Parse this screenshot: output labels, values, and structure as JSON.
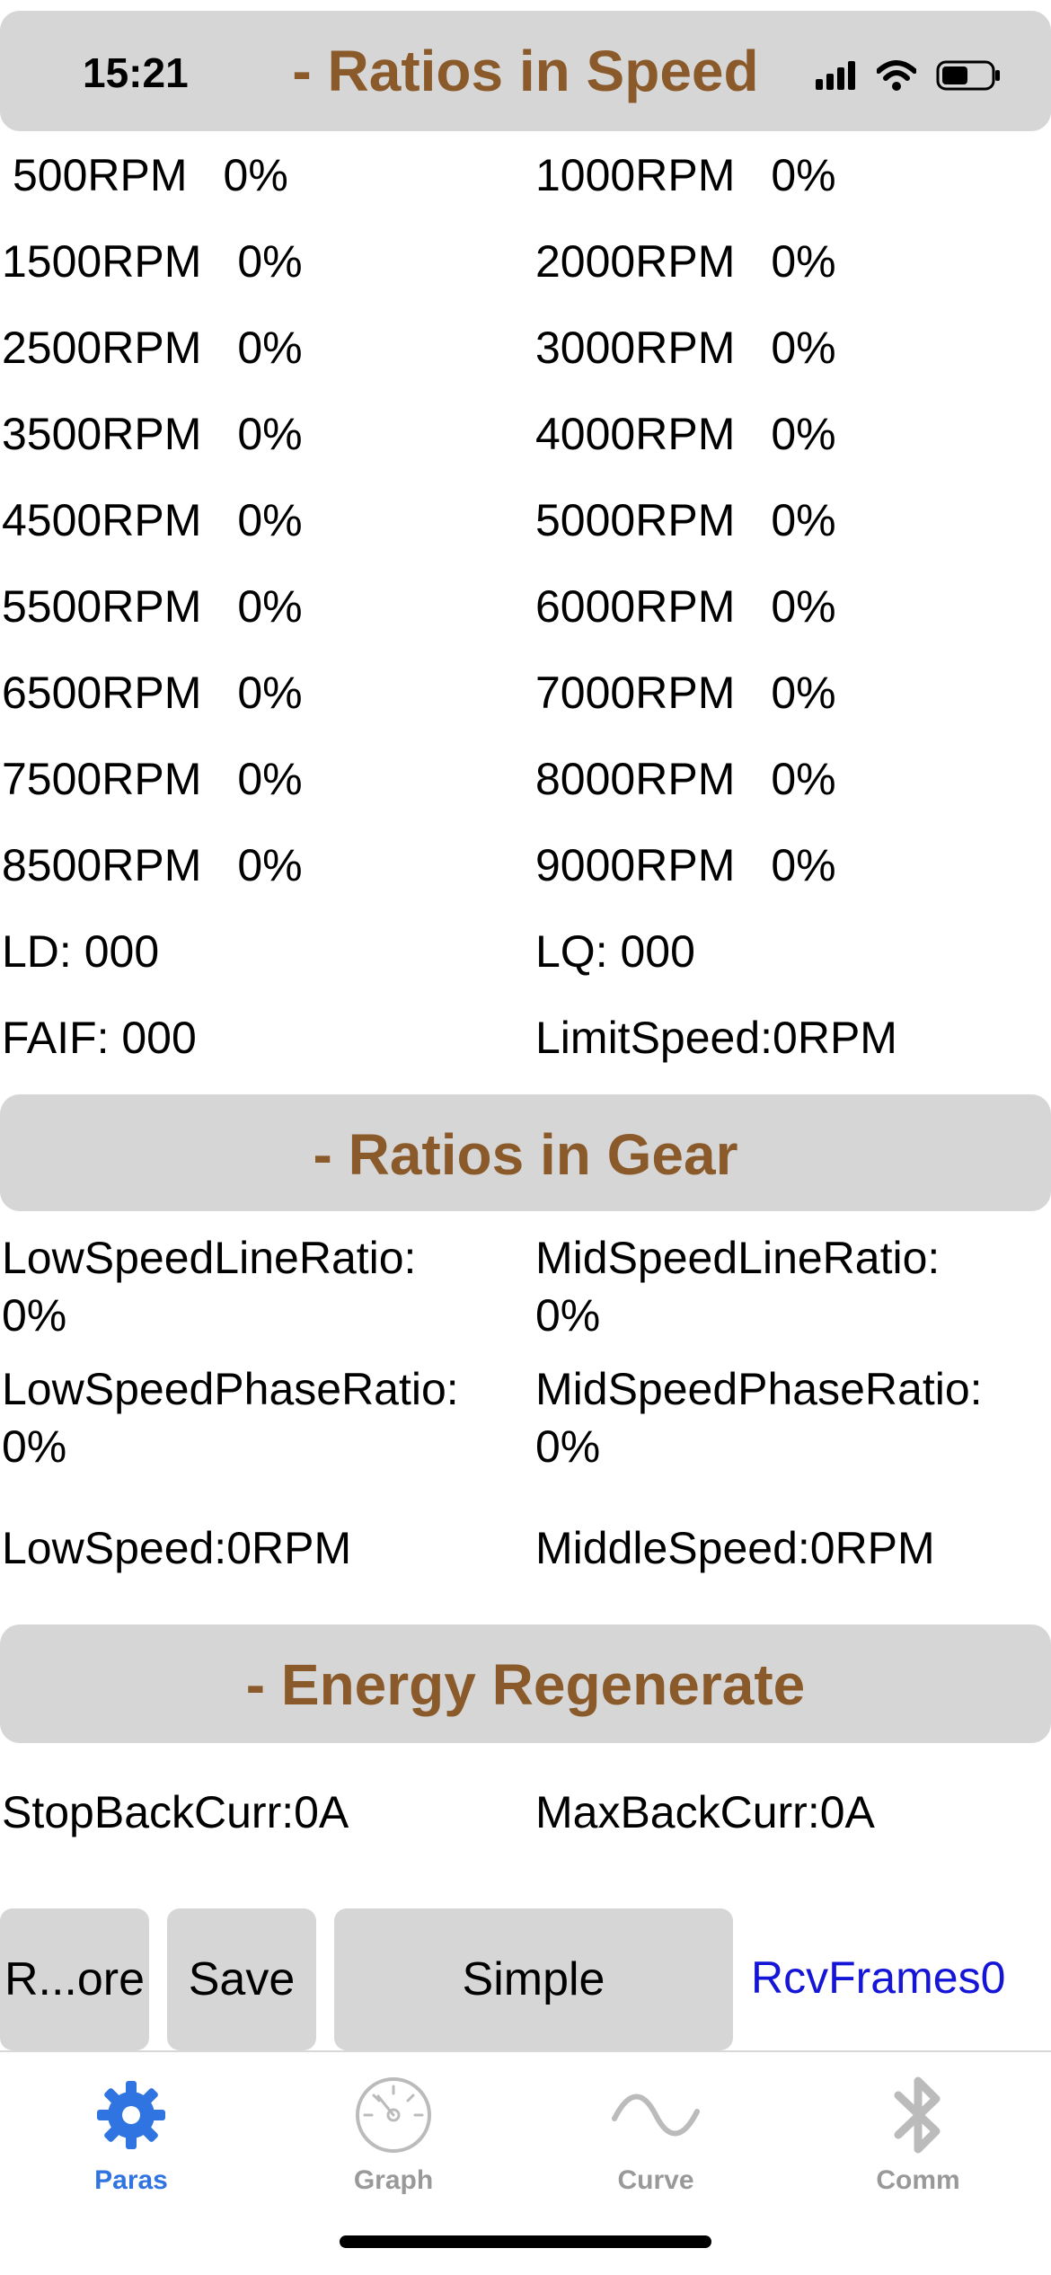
{
  "status": {
    "time": "15:21"
  },
  "speed_section": {
    "title": "- Ratios in Speed",
    "rows": [
      [
        {
          "label": "500RPM",
          "value": "0%"
        },
        {
          "label": "1000RPM",
          "value": "0%"
        }
      ],
      [
        {
          "label": "1500RPM",
          "value": "0%"
        },
        {
          "label": "2000RPM",
          "value": "0%"
        }
      ],
      [
        {
          "label": "2500RPM",
          "value": "0%"
        },
        {
          "label": "3000RPM",
          "value": "0%"
        }
      ],
      [
        {
          "label": "3500RPM",
          "value": "0%"
        },
        {
          "label": "4000RPM",
          "value": "0%"
        }
      ],
      [
        {
          "label": "4500RPM",
          "value": "0%"
        },
        {
          "label": "5000RPM",
          "value": "0%"
        }
      ],
      [
        {
          "label": "5500RPM",
          "value": "0%"
        },
        {
          "label": "6000RPM",
          "value": "0%"
        }
      ],
      [
        {
          "label": "6500RPM",
          "value": "0%"
        },
        {
          "label": "7000RPM",
          "value": "0%"
        }
      ],
      [
        {
          "label": "7500RPM",
          "value": "0%"
        },
        {
          "label": "8000RPM",
          "value": "0%"
        }
      ],
      [
        {
          "label": "8500RPM",
          "value": "0%"
        },
        {
          "label": "9000RPM",
          "value": "0%"
        }
      ]
    ],
    "ld": "LD: 000",
    "lq": "LQ: 000",
    "faif": "FAIF: 000",
    "limit_speed": "LimitSpeed:0RPM"
  },
  "gear_section": {
    "title": "- Ratios in Gear",
    "low_line_label": "LowSpeedLineRatio:",
    "low_line_value": "0%",
    "mid_line_label": "MidSpeedLineRatio:",
    "mid_line_value": "0%",
    "low_phase_label": "LowSpeedPhaseRatio:",
    "low_phase_value": "0%",
    "mid_phase_label": "MidSpeedPhaseRatio:",
    "mid_phase_value": "0%",
    "low_speed": "LowSpeed:0RPM",
    "middle_speed": "MiddleSpeed:0RPM"
  },
  "energy_section": {
    "title": "- Energy Regenerate",
    "stop_back": "StopBackCurr:0A",
    "max_back": "MaxBackCurr:0A"
  },
  "actions": {
    "restore_label": "R...ore",
    "save_label": "Save",
    "simple_label": "Simple",
    "rcv_frames": "RcvFrames0"
  },
  "tabs": [
    {
      "label": "Paras",
      "icon": "gear-icon",
      "active": true
    },
    {
      "label": "Graph",
      "icon": "gauge-icon",
      "active": false
    },
    {
      "label": "Curve",
      "icon": "wave-icon",
      "active": false
    },
    {
      "label": "Comm",
      "icon": "bluetooth-icon",
      "active": false
    }
  ],
  "colors": {
    "section_title": "#8b5a2b",
    "section_bg": "#d6d6d6",
    "tab_active": "#2f74e0",
    "tab_inactive": "#999999",
    "rcv_frames": "#1515d8"
  }
}
